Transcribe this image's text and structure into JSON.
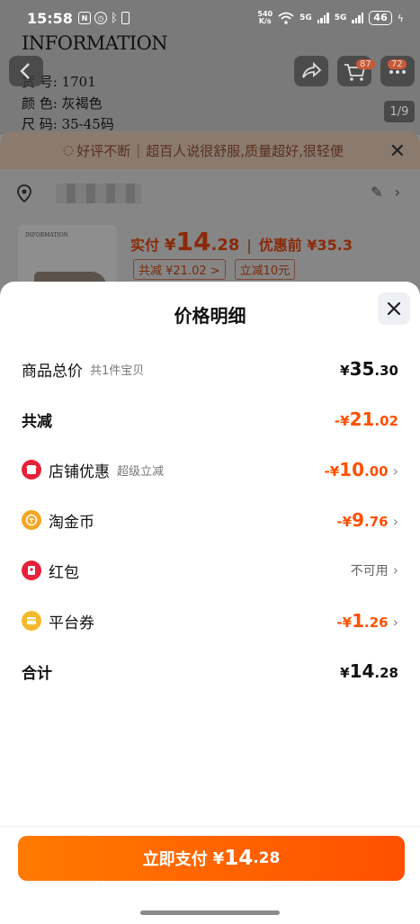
{
  "status_bar": {
    "time": "15:58",
    "speed_top": "540",
    "speed_bottom": "K/s",
    "signal1": "5G",
    "signal2": "5G",
    "battery": "46"
  },
  "background": {
    "info_title": "INFORMATION",
    "info_lines": [
      "货  号: 1701",
      "颜  色: 灰褐色",
      "尺  码: 35-45码"
    ],
    "cart_badge": "87",
    "more_badge": "72",
    "photo_counter": "1/9",
    "banner_parts": [
      "好评不断",
      "超百人说很舒服,质量超好,很轻便"
    ],
    "thumb_text": "INFORMATION",
    "pay_label": "实付",
    "pay_currency": "¥",
    "pay_int": "14",
    "pay_dec": ".28",
    "pre_discount": "优惠前 ¥35.3",
    "tag1": "共减 ¥21.02 >",
    "tag2": "立减10元"
  },
  "modal": {
    "title": "价格明细",
    "rows": [
      {
        "label": "商品总价",
        "sub": "共1件宝贝",
        "currency": "¥",
        "int": "35",
        "dec": ".30"
      },
      {
        "label": "共减",
        "currency": "-¥",
        "int": "21",
        "dec": ".02"
      },
      {
        "label": "店铺优惠",
        "sub": "超级立减",
        "icon": "shop-icon",
        "currency": "-¥",
        "int": "10",
        "dec": ".00"
      },
      {
        "label": "淘金币",
        "icon": "coin-icon",
        "currency": "-¥",
        "int": "9",
        "dec": ".76"
      },
      {
        "label": "红包",
        "icon": "red-packet-icon",
        "value": "不可用"
      },
      {
        "label": "平台券",
        "icon": "coupon-icon",
        "currency": "-¥",
        "int": "1",
        "dec": ".26"
      },
      {
        "label": "合计",
        "currency": "¥",
        "int": "14",
        "dec": ".28"
      }
    ]
  },
  "pay_button": {
    "label": "立即支付",
    "currency": "¥",
    "int": "14",
    "dec": ".28"
  },
  "colors": {
    "accent": "#ff5000",
    "accent_gradient_start": "#ff7a00",
    "shop_icon": "#e8203a",
    "coin_icon": "#f5a623",
    "red_packet_icon": "#e8203a",
    "coupon_icon": "#f5b82e"
  }
}
